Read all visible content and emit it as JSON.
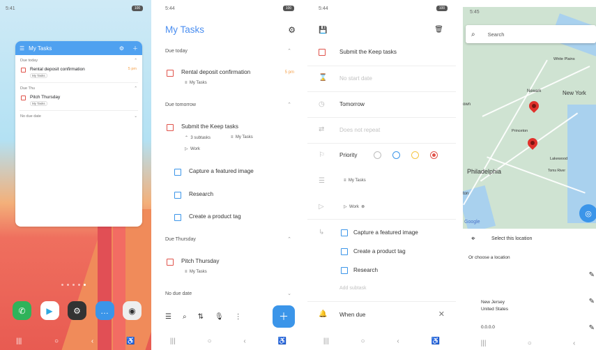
{
  "s1": {
    "time": "5:41",
    "battery": "100",
    "widget": {
      "title": "My Tasks",
      "sections": [
        {
          "label": "Due today",
          "task": "Rental deposit confirmation",
          "time": "5 pm",
          "chip": "My Tasks"
        },
        {
          "label": "Due Thu",
          "task": "Pitch Thursday",
          "chip": "My Tasks"
        },
        {
          "label": "No due date"
        }
      ]
    }
  },
  "s2": {
    "time": "5:44",
    "title": "My Tasks",
    "sections": {
      "today": "Due today",
      "tomorrow": "Due tomorrow",
      "thursday": "Due Thursday",
      "none": "No due date"
    },
    "tasks": {
      "rental": "Rental deposit confirmation",
      "rental_time": "5 pm",
      "rental_list": "My Tasks",
      "keep": "Submit the Keep tasks",
      "keep_subtasks": "3 subtasks",
      "keep_list": "My Tasks",
      "keep_tag": "Work",
      "sub1": "Capture a featured image",
      "sub2": "Research",
      "sub3": "Create a product tag",
      "pitch": "Pitch Thursday",
      "pitch_list": "My Tasks"
    }
  },
  "s3": {
    "time": "5:44",
    "title": "Submit the Keep tasks",
    "start": "No start date",
    "due": "Tomorrow",
    "repeat": "Does not repeat",
    "priority": "Priority",
    "list": "My Tasks",
    "tag": "Work",
    "subtasks": [
      "Capture a featured image",
      "Create a product tag",
      "Research"
    ],
    "add_subtask": "Add subtask",
    "when_due": "When due"
  },
  "s4": {
    "time": "5:45",
    "search_placeholder": "Search",
    "select_location": "Select this location",
    "choose": "Or choose a location",
    "place_name": "New Jersey",
    "place_country": "United States",
    "coords": "0.0.0.0",
    "map_labels": [
      "White Plains",
      "Newark",
      "New York",
      "Princeton",
      "Lakewood",
      "Philadelphia",
      "Toms River",
      "own",
      "ton",
      "Google"
    ]
  },
  "colors": {
    "accent": "#3b95e9",
    "checkbox": "#e0524a"
  }
}
